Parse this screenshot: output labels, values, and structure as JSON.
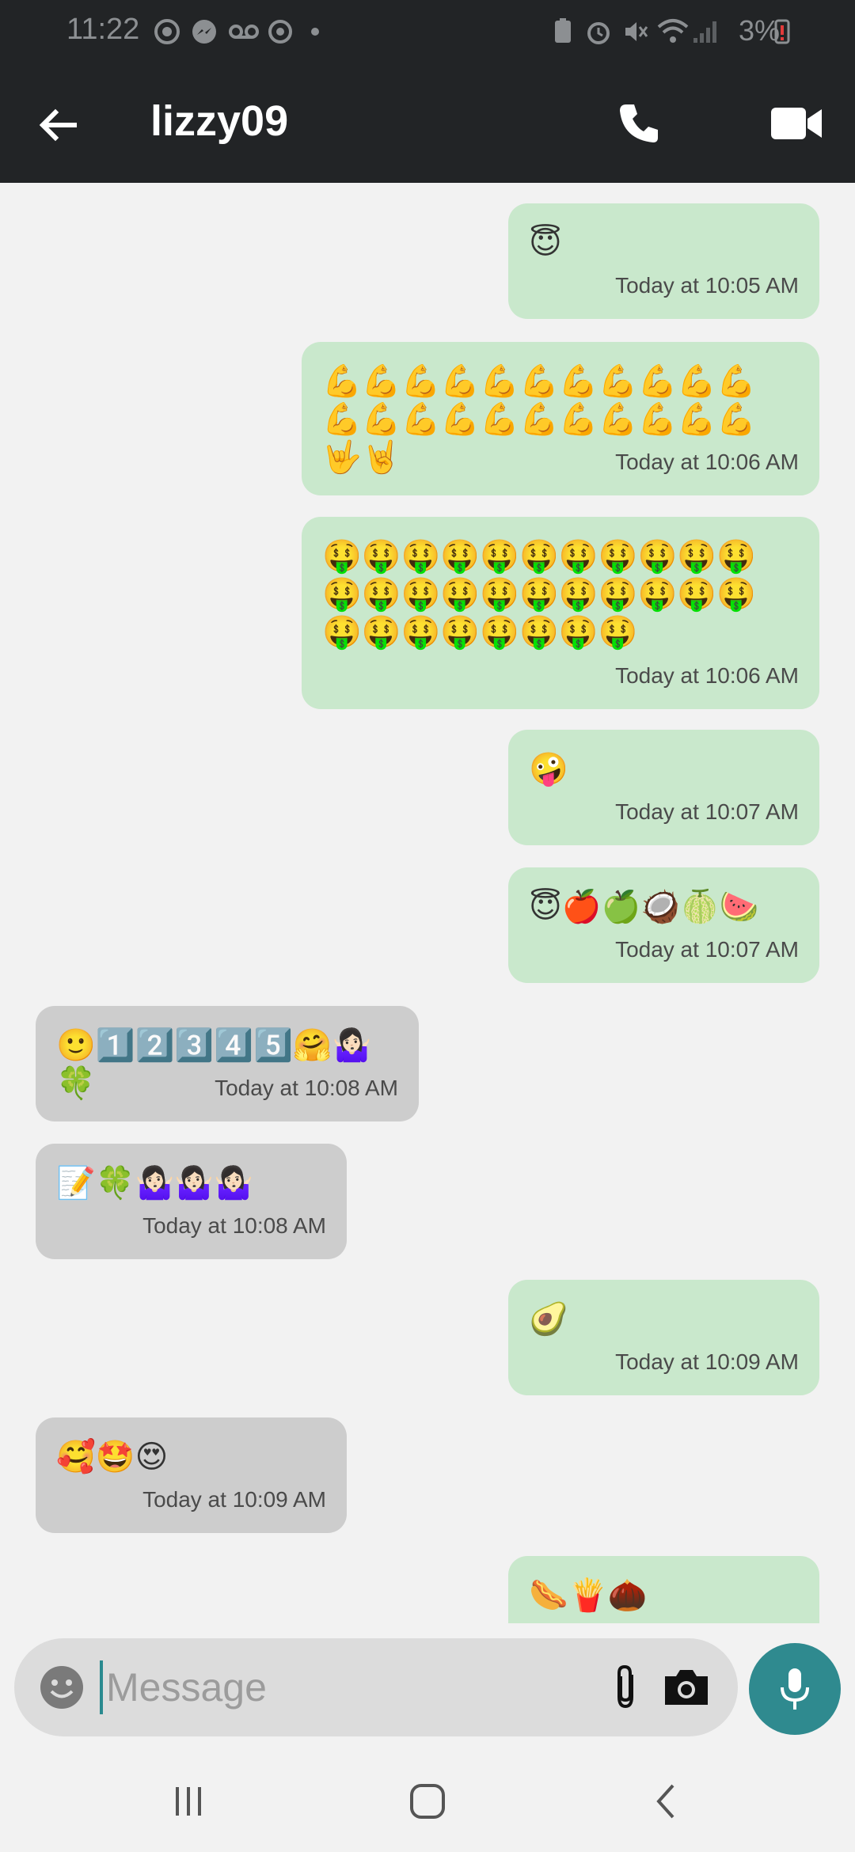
{
  "status_bar": {
    "time": "11:22",
    "battery": "3%",
    "icons": [
      "signal-app-icon",
      "messenger-icon",
      "voicemail-icon",
      "sync-icon",
      "dot-icon",
      "battery-saver-icon",
      "alarm-icon",
      "mute-icon",
      "wifi-icon",
      "signal-bars-icon",
      "battery-low-icon"
    ]
  },
  "header": {
    "title": "lizzy09",
    "back_icon": "arrow-left-icon",
    "call_icon": "phone-icon",
    "video_icon": "video-camera-icon"
  },
  "messages": [
    {
      "direction": "out",
      "text": "😇",
      "timestamp": "Today at 10:05 AM"
    },
    {
      "direction": "out",
      "text": "💪💪💪💪💪💪💪💪💪💪💪💪💪💪💪💪💪💪💪💪💪💪🤟🤘",
      "timestamp": "Today at 10:06 AM"
    },
    {
      "direction": "out",
      "text": "🤑🤑🤑🤑🤑🤑🤑🤑🤑🤑🤑🤑🤑🤑🤑🤑🤑🤑🤑🤑🤑🤑🤑🤑🤑🤑🤑🤑🤑🤑",
      "timestamp": "Today at 10:06 AM"
    },
    {
      "direction": "out",
      "text": "🤪",
      "timestamp": "Today at 10:07 AM"
    },
    {
      "direction": "out",
      "text": "😇🍎🍏🥥🍈🍉",
      "timestamp": "Today at 10:07 AM"
    },
    {
      "direction": "in",
      "text": "🙂1️⃣2️⃣3️⃣4️⃣5️⃣🤗🤷🏻‍♀️🍀",
      "timestamp": "Today at 10:08 AM"
    },
    {
      "direction": "in",
      "text": "📝🍀🤷🏻‍♀️🤷🏻‍♀️🤷🏻‍♀️",
      "timestamp": "Today at 10:08 AM"
    },
    {
      "direction": "out",
      "text": "🥑",
      "timestamp": "Today at 10:09 AM"
    },
    {
      "direction": "in",
      "text": "🥰🤩😍",
      "timestamp": "Today at 10:09 AM"
    },
    {
      "direction": "out",
      "text": "🌭🍟🌰",
      "timestamp": ""
    }
  ],
  "composer": {
    "placeholder": "Message",
    "value": "",
    "emoji_icon": "smiley-icon",
    "attach_icon": "paperclip-icon",
    "camera_icon": "camera-icon",
    "mic_icon": "microphone-icon"
  },
  "nav_bar": {
    "recents_icon": "recents-icon",
    "home_icon": "home-icon",
    "back_icon": "back-chevron-icon"
  },
  "colors": {
    "app_bar": "#222426",
    "outgoing_bubble": "#c9e8cc",
    "incoming_bubble": "#cdcdcd",
    "accent": "#2f8a8f",
    "background": "#f2f2f2"
  }
}
